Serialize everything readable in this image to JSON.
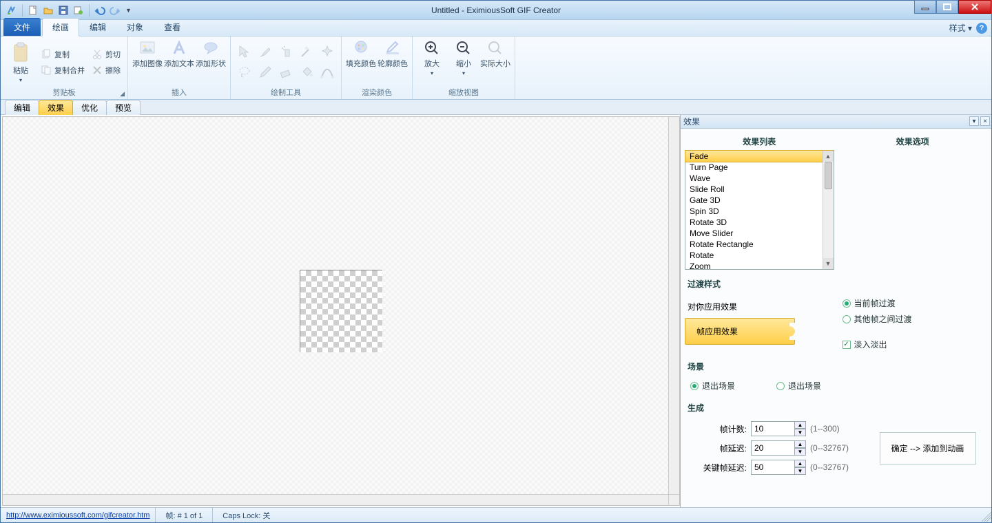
{
  "title": "Untitled - EximiousSoft GIF Creator",
  "ribbon_tabs": {
    "file": "文件",
    "draw": "绘画",
    "edit": "编辑",
    "object": "对象",
    "view": "查看"
  },
  "ribbon_right": {
    "style": "样式",
    "style_arrow": "▾"
  },
  "groups": {
    "clipboard": {
      "label": "剪贴板",
      "paste": "粘贴",
      "copy": "复制",
      "copy_merge": "复制合并",
      "cut": "剪切",
      "erase": "擦除"
    },
    "insert": {
      "label": "插入",
      "image": "添加图像",
      "text": "添加文本",
      "shape": "添加形状"
    },
    "drawtools": {
      "label": "绘制工具"
    },
    "rendercolor": {
      "label": "渲染颜色",
      "fill": "填充颜色",
      "stroke": "轮廓颜色"
    },
    "zoom": {
      "label": "缩放视图",
      "in": "放大",
      "out": "缩小",
      "actual": "实际大小"
    }
  },
  "wstabs": {
    "edit": "编辑",
    "effect": "效果",
    "optimize": "优化",
    "preview": "预览"
  },
  "panel": {
    "title": "效果",
    "list_header": "效果列表",
    "options_header": "效果选项",
    "effects": [
      "Fade",
      "Turn Page",
      "Wave",
      "Slide Roll",
      "Gate 3D",
      "Spin 3D",
      "Rotate 3D",
      "Move Slider",
      "Rotate Rectangle",
      "Rotate",
      "Zoom"
    ],
    "transition_header": "过渡样式",
    "apply_to_you": "对你应用效果",
    "apply_btn": "帧应用效果",
    "current_frame": "当前帧过渡",
    "other_frames": "其他帧之间过渡",
    "fadeinout": "淡入淡出",
    "scene_header": "场景",
    "exit_scene_a": "退出场景",
    "exit_scene_b": "退出场景",
    "generate_header": "生成",
    "frame_count_label": "帧计数:",
    "frame_count_value": "10",
    "frame_count_range": "(1--300)",
    "frame_delay_label": "帧延迟:",
    "frame_delay_value": "20",
    "frame_delay_range": "(0--32767)",
    "key_delay_label": "关键帧延迟:",
    "key_delay_value": "50",
    "key_delay_range": "(0--32767)",
    "ok_btn": "确定 --> 添加到动画"
  },
  "status": {
    "url": "http://www.eximioussoft.com/gifcreator.htm",
    "frame": "帧: # 1 of 1",
    "caps": "Caps Lock: 关"
  }
}
